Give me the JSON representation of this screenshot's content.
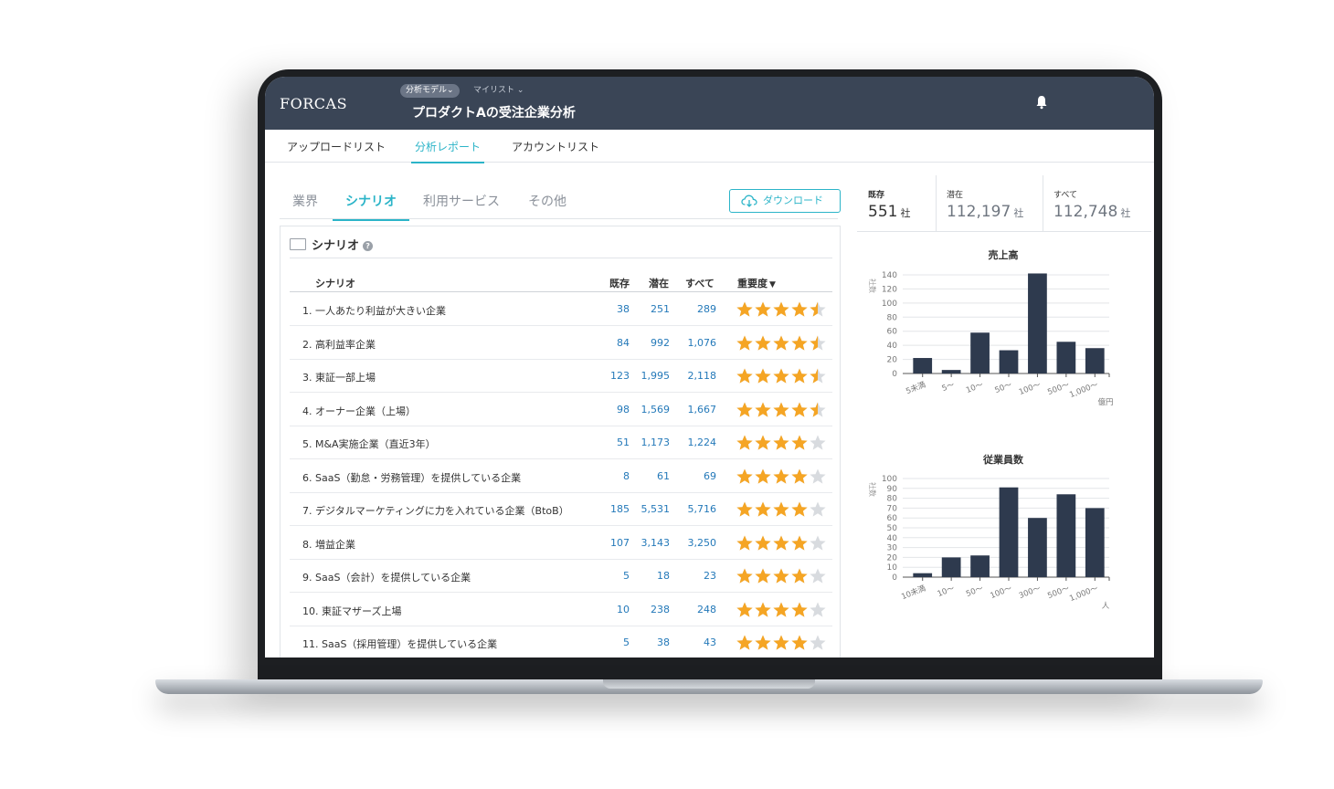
{
  "app": {
    "logo": "FORCAS",
    "model_pill": "分析モデル⌄",
    "mylist": "マイリスト ⌄",
    "title": "プロダクトAの受注企業分析"
  },
  "nav": {
    "tabs": [
      {
        "label": "アップロードリスト",
        "active": false
      },
      {
        "label": "分析レポート",
        "active": true
      },
      {
        "label": "アカウントリスト",
        "active": false
      }
    ]
  },
  "sub_tabs": [
    {
      "label": "業界",
      "active": false
    },
    {
      "label": "シナリオ",
      "active": true
    },
    {
      "label": "利用サービス",
      "active": false
    },
    {
      "label": "その他",
      "active": false
    }
  ],
  "download_label": "ダウンロード",
  "panel": {
    "title": "シナリオ",
    "help": "?",
    "columns": {
      "scenario": "シナリオ",
      "existing": "既存",
      "potential": "潜在",
      "all": "すべて",
      "importance": "重要度"
    },
    "sort_indicator": "▼",
    "rows": [
      {
        "name": "1. 一人あたり利益が大きい企業",
        "existing": "38",
        "potential": "251",
        "all": "289",
        "rating": 4.5
      },
      {
        "name": "2. 高利益率企業",
        "existing": "84",
        "potential": "992",
        "all": "1,076",
        "rating": 4.5
      },
      {
        "name": "3. 東証一部上場",
        "existing": "123",
        "potential": "1,995",
        "all": "2,118",
        "rating": 4.5
      },
      {
        "name": "4. オーナー企業（上場）",
        "existing": "98",
        "potential": "1,569",
        "all": "1,667",
        "rating": 4.5
      },
      {
        "name": "5. M&A実施企業（直近3年）",
        "existing": "51",
        "potential": "1,173",
        "all": "1,224",
        "rating": 4
      },
      {
        "name": "6. SaaS（勤怠・労務管理）を提供している企業",
        "existing": "8",
        "potential": "61",
        "all": "69",
        "rating": 4
      },
      {
        "name": "7. デジタルマーケティングに力を入れている企業（BtoB）",
        "existing": "185",
        "potential": "5,531",
        "all": "5,716",
        "rating": 4
      },
      {
        "name": "8. 増益企業",
        "existing": "107",
        "potential": "3,143",
        "all": "3,250",
        "rating": 4
      },
      {
        "name": "9. SaaS（会計）を提供している企業",
        "existing": "5",
        "potential": "18",
        "all": "23",
        "rating": 4
      },
      {
        "name": "10. 東証マザーズ上場",
        "existing": "10",
        "potential": "238",
        "all": "248",
        "rating": 4
      },
      {
        "name": "11. SaaS（採用管理）を提供している企業",
        "existing": "5",
        "potential": "38",
        "all": "43",
        "rating": 4
      }
    ]
  },
  "stats": [
    {
      "label": "既存",
      "value": "551",
      "unit": "社"
    },
    {
      "label": "潜在",
      "value": "112,197",
      "unit": "社"
    },
    {
      "label": "すべて",
      "value": "112,748",
      "unit": "社"
    }
  ],
  "colors": {
    "accent": "#2bb4c8",
    "header": "#3a4556",
    "bar": "#2e3a4e",
    "link": "#2479b9",
    "star": "#f5a524",
    "star_empty": "#d8dbdf"
  },
  "chart_data": [
    {
      "type": "bar",
      "title": "売上高",
      "ylabel": "社数",
      "xunit": "億円",
      "categories": [
        "5未満",
        "5〜",
        "10〜",
        "50〜",
        "100〜",
        "500〜",
        "1,000〜"
      ],
      "values": [
        22,
        5,
        58,
        33,
        142,
        45,
        36
      ],
      "ylim": [
        0,
        140
      ],
      "yticks": [
        0,
        20,
        40,
        60,
        80,
        100,
        120,
        140
      ]
    },
    {
      "type": "bar",
      "title": "従業員数",
      "ylabel": "社数",
      "xunit": "人",
      "categories": [
        "10未満",
        "10〜",
        "50〜",
        "100〜",
        "300〜",
        "500〜",
        "1,000〜"
      ],
      "values": [
        4,
        20,
        22,
        91,
        60,
        84,
        70
      ],
      "ylim": [
        0,
        100
      ],
      "yticks": [
        0,
        10,
        20,
        30,
        40,
        50,
        60,
        70,
        80,
        90,
        100
      ]
    }
  ]
}
